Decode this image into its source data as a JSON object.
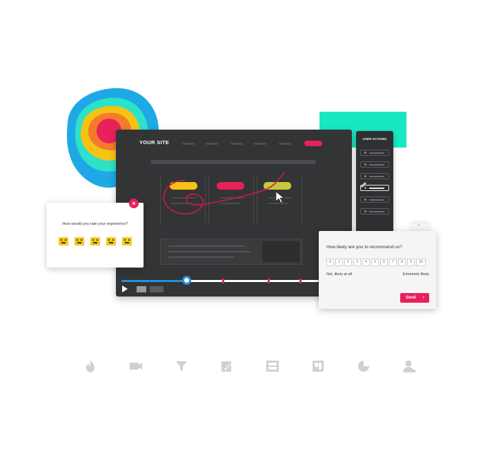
{
  "colors": {
    "accent": "#e8215a",
    "timeline": "#2a8fd8",
    "teal": "#17e8c2",
    "emoji": "#f6c917",
    "window": "#333436",
    "icon_gray": "#d0d0d0"
  },
  "site": {
    "title": "YOUR SITE"
  },
  "user_actions": {
    "title": "USER ACTIONS"
  },
  "rating_popup": {
    "question": "How would you rate your experience?",
    "close_icon": "×",
    "faces": [
      "very-bad-face-icon",
      "bad-face-icon",
      "neutral-face-icon",
      "good-face-icon",
      "very-good-face-icon"
    ]
  },
  "nps_popup": {
    "question": "How likely are you to recommend us?",
    "scale": [
      "0",
      "1",
      "2",
      "3",
      "4",
      "5",
      "6",
      "7",
      "8",
      "9",
      "10"
    ],
    "low_label": "Not, likely at all",
    "high_label": "Extremely likely",
    "send_label": "Send",
    "send_icon": "›",
    "collapse_icon": "ˇ"
  },
  "player": {
    "progress": 0.33
  },
  "feature_icons": [
    "flame-icon",
    "video-camera-icon",
    "funnel-icon",
    "form-edit-icon",
    "survey-icon",
    "layout-icon",
    "pie-chart-icon",
    "user-icon"
  ]
}
